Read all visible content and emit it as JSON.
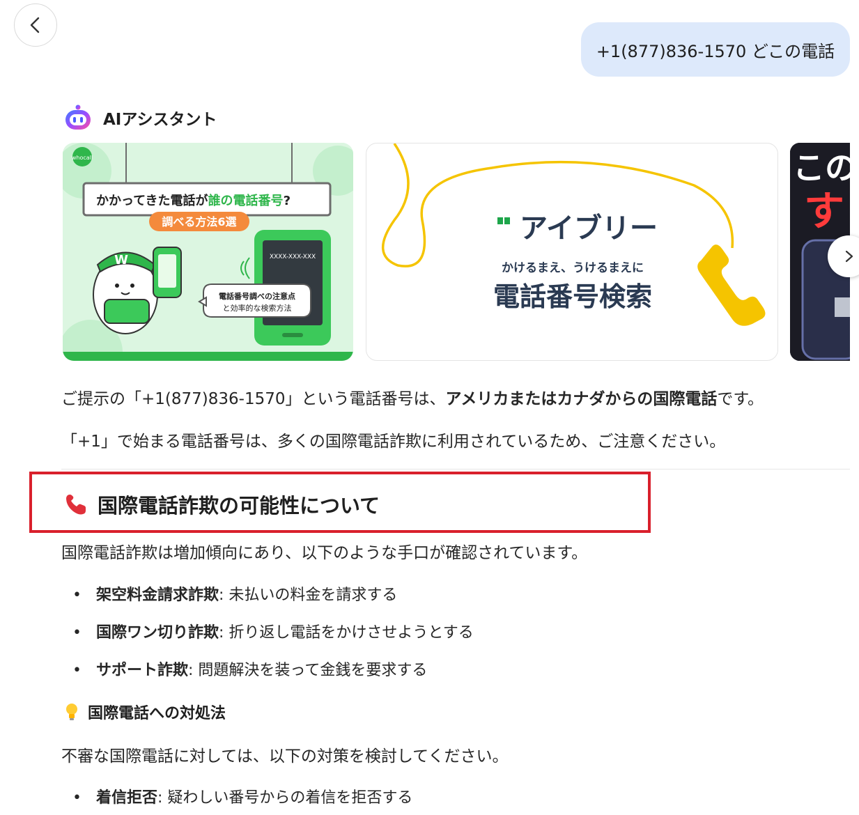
{
  "user_message": "+1(877)836-1570 どこの電話",
  "assistant": {
    "name": "AIアシスタント"
  },
  "cards": [
    {
      "headline_prefix": "かかってきた電話が",
      "headline_highlight": "誰の電話番号",
      "headline_suffix": "?",
      "tag": "調べる方法6選",
      "phone_screen": "XXXX-XXX-XXX",
      "bubble_line1": "電話番号調べの注意点",
      "bubble_line2": "と効率的な検索方法",
      "badge": "W",
      "logo_badge": "whocall"
    },
    {
      "brand": "アイブリー",
      "tagline": "かけるまえ、うけるまえに",
      "title": "電話番号検索"
    },
    {
      "line1": "この",
      "line2": "す"
    }
  ],
  "answer": {
    "p1_before": "ご提示の「+1(877)836-1570」という電話番号は、",
    "p1_bold": "アメリカまたはカナダからの国際電話",
    "p1_after": "です。",
    "p2": "「+1」で始まる電話番号は、多くの国際電話詐欺に利用されているため、ご注意ください。",
    "section_title": "国際電話詐欺の可能性について",
    "p3": "国際電話詐欺は増加傾向にあり、以下のような手口が確認されています。",
    "bullets": [
      {
        "term": "架空料金請求詐欺",
        "desc": ": 未払いの料金を請求する"
      },
      {
        "term": "国際ワン切り詐欺",
        "desc": ": 折り返し電話をかけさせようとする"
      },
      {
        "term": "サポート詐欺",
        "desc": ": 問題解決を装って金銭を要求する"
      }
    ],
    "subhead": "国際電話への対処法",
    "p4": "不審な国際電話に対しては、以下の対策を検討してください。",
    "bullets2": [
      {
        "term": "着信拒否",
        "desc": ": 疑わしい番号からの着信を拒否する"
      }
    ]
  },
  "colors": {
    "user_bubble": "#dde9fb",
    "highlight_border": "#d9202c",
    "card_green": "#3cc95a",
    "brand_yellow": "#f5c400"
  }
}
